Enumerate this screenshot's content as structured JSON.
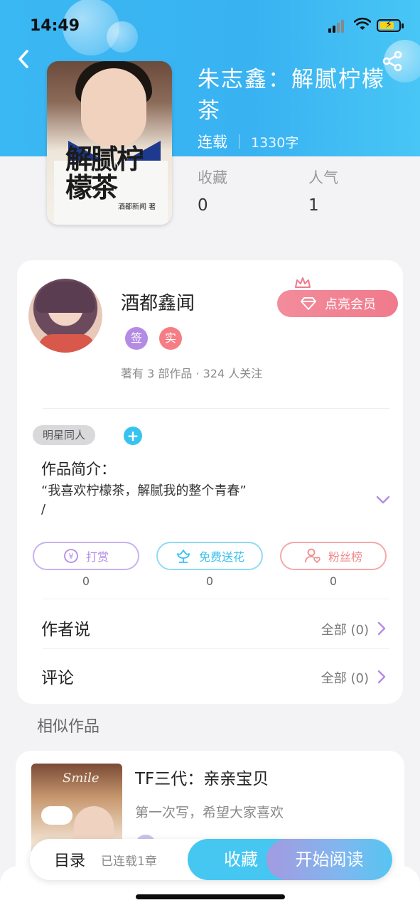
{
  "status_bar": {
    "time": "14:49"
  },
  "book": {
    "title": "朱志鑫：解腻柠檬茶",
    "status": "连载",
    "words": "1330字",
    "cover_title": "解腻柠檬茶",
    "cover_author": "酒都新闻 著",
    "stats": [
      {
        "label": "收藏",
        "value": "0"
      },
      {
        "label": "人气",
        "value": "1"
      }
    ]
  },
  "author": {
    "name": "酒都鑫闻",
    "badges": [
      {
        "text": "签",
        "color": "#b48be4"
      },
      {
        "text": "实",
        "color": "#f47e84"
      }
    ],
    "stats_line": "著有 3 部作品 · 324 人关注",
    "vip_button": "点亮会员"
  },
  "tags": {
    "items": [
      "明星同人"
    ],
    "add": "+"
  },
  "intro": {
    "title": "作品简介：",
    "text": "“我喜欢柠檬茶，解腻我的整个青春”\n/"
  },
  "actions": [
    {
      "label": "打赏",
      "count": "0",
      "color": "#b48be4"
    },
    {
      "label": "免费送花",
      "count": "0",
      "color": "#39c1ee"
    },
    {
      "label": "粉丝榜",
      "count": "0",
      "color": "#f08a8a"
    }
  ],
  "rows": [
    {
      "title": "作者说",
      "right": "全部 (0)"
    },
    {
      "title": "评论",
      "right": "全部 (0)"
    }
  ],
  "similar": {
    "heading": "相似作品",
    "items": [
      {
        "title": "TF三代：亲亲宝贝",
        "desc": "第一次写，希望大家喜欢",
        "cover_text": "Smile"
      }
    ]
  },
  "bottom_bar": {
    "toc_label": "目录",
    "toc_count": "已连载1章",
    "fav_label": "收藏",
    "read_label": "开始阅读"
  },
  "colors": {
    "hero": "#3ab8f3",
    "accent": "#45c7f2",
    "vip": "#f07a8c"
  }
}
